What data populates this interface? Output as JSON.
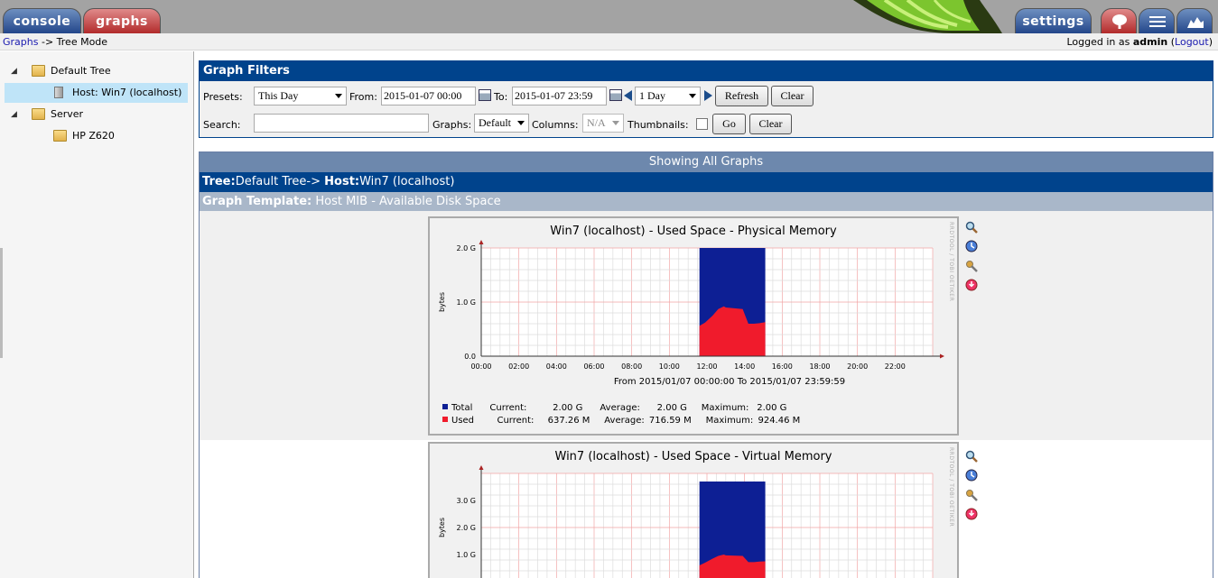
{
  "header": {
    "tabs": [
      {
        "label": "console"
      },
      {
        "label": "graphs"
      },
      {
        "label": "settings"
      }
    ]
  },
  "breadcrumb": {
    "root": "Graphs",
    "separator": "->",
    "current": "Tree Mode"
  },
  "login": {
    "prefix": "Logged in as",
    "user": "admin",
    "logout": "Logout"
  },
  "tree": {
    "nodes": [
      {
        "label": "Default Tree"
      },
      {
        "label": "Host: Win7 (localhost)"
      },
      {
        "label": "Server"
      },
      {
        "label": "HP Z620"
      }
    ]
  },
  "filters": {
    "title": "Graph Filters",
    "presets_label": "Presets:",
    "preset_value": "This Day",
    "from_label": "From:",
    "from_value": "2015-01-07 00:00",
    "to_label": "To:",
    "to_value": "2015-01-07 23:59",
    "span_value": "1 Day",
    "refresh": "Refresh",
    "clear": "Clear",
    "search_label": "Search:",
    "search_value": "",
    "graphs_label": "Graphs:",
    "graphs_value": "Default",
    "columns_label": "Columns:",
    "columns_value": "N/A",
    "thumbnails_label": "Thumbnails:",
    "go": "Go",
    "clear2": "Clear"
  },
  "graphs_area": {
    "showing": "Showing All Graphs",
    "tree_label": "Tree:",
    "tree_value": "Default Tree->",
    "host_label": "Host:",
    "host_value": "Win7 (localhost)",
    "template_label": "Graph Template:",
    "template_value": "Host MIB - Available Disk Space"
  },
  "side_watermark": "RRDTOOL / TOBI OETIKER",
  "colors": {
    "total": "#0d1f94",
    "used": "#f01b2c",
    "accent": "#00438C"
  },
  "chart_data": [
    {
      "type": "area",
      "title": "Win7 (localhost) - Used Space - Physical Memory",
      "ylabel": "bytes",
      "xlabel": "From 2015/01/07 00:00:00 To 2015/01/07 23:59:59",
      "x_ticks": [
        "00:00",
        "02:00",
        "04:00",
        "06:00",
        "08:00",
        "10:00",
        "12:00",
        "14:00",
        "16:00",
        "18:00",
        "20:00",
        "22:00"
      ],
      "y_ticks": [
        "0.0",
        "1.0 G",
        "2.0 G"
      ],
      "xlim": [
        0,
        24
      ],
      "ylim": [
        0,
        2.0
      ],
      "grid": true,
      "series": [
        {
          "name": "Total",
          "color": "#0d1f94",
          "x": [
            11.6,
            15.1
          ],
          "values": [
            2.0,
            2.0
          ]
        },
        {
          "name": "Used",
          "color": "#f01b2c",
          "x": [
            11.6,
            11.9,
            12.3,
            12.6,
            12.9,
            13.0,
            13.9,
            14.2,
            14.5,
            14.8,
            15.1
          ],
          "values": [
            0.56,
            0.62,
            0.75,
            0.87,
            0.92,
            0.9,
            0.87,
            0.6,
            0.6,
            0.61,
            0.63
          ]
        }
      ],
      "legend": [
        {
          "name": "Total",
          "current": "2.00 G",
          "average": "2.00 G",
          "maximum": "2.00 G"
        },
        {
          "name": "Used",
          "current": "637.26 M",
          "average": "716.59 M",
          "maximum": "924.46 M"
        }
      ]
    },
    {
      "type": "area",
      "title": "Win7 (localhost) - Used Space - Virtual Memory",
      "ylabel": "bytes",
      "x_ticks": [],
      "y_ticks": [
        "1.0 G",
        "2.0 G",
        "3.0 G"
      ],
      "xlim": [
        0,
        24
      ],
      "ylim": [
        0,
        4.0
      ],
      "grid": true,
      "series": [
        {
          "name": "Total",
          "color": "#0d1f94",
          "x": [
            11.6,
            15.1
          ],
          "values": [
            3.7,
            3.7
          ]
        },
        {
          "name": "Used",
          "color": "#f01b2c",
          "x": [
            11.6,
            11.9,
            12.3,
            12.6,
            12.9,
            13.0,
            13.9,
            14.2,
            14.5,
            14.8,
            15.1
          ],
          "values": [
            0.6,
            0.7,
            0.85,
            0.95,
            1.0,
            0.97,
            0.95,
            0.72,
            0.72,
            0.74,
            0.75
          ]
        }
      ],
      "legend": []
    }
  ]
}
